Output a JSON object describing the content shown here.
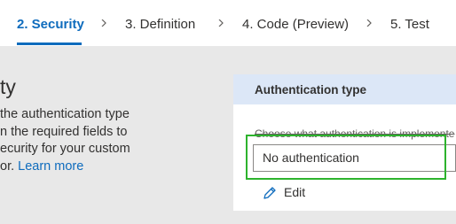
{
  "steps": [
    {
      "label": "2. Security",
      "active": true
    },
    {
      "label": "3. Definition",
      "active": false
    },
    {
      "label": "4. Code (Preview)",
      "active": false
    },
    {
      "label": "5. Test",
      "active": false
    }
  ],
  "section": {
    "heading": "ty",
    "desc_lines": [
      "the authentication type",
      "n the required fields to",
      "ecurity for your custom"
    ],
    "desc_last_prefix": "or. ",
    "learn_more": "Learn more"
  },
  "auth_card": {
    "title": "Authentication type",
    "field_label": "Choose what authentication is implemente",
    "selected_value": "No authentication",
    "edit_label": "Edit"
  },
  "colors": {
    "accent": "#0f6cbd",
    "highlight_border": "#2db32d",
    "card_header_bg": "#dce7f7",
    "body_bg": "#e8e8e8"
  }
}
